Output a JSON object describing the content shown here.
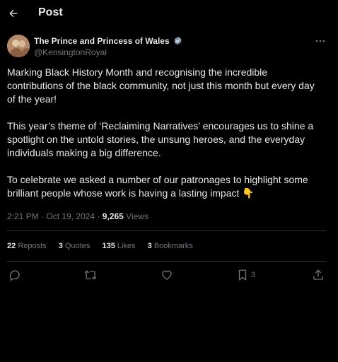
{
  "header": {
    "title": "Post"
  },
  "author": {
    "name": "The Prince and Princess of Wales",
    "handle": "@KensingtonRoyal"
  },
  "tweet": {
    "paragraphs": [
      "Marking Black History Month and recognising the incredible contributions of the black community, not just this month but every day of the year!",
      "This year’s theme of ‘Reclaiming Narratives’ encourages us to shine a spotlight on the untold stories, the unsung heroes, and the everyday individuals making a big difference.",
      "To celebrate we asked a number of our patronages to highlight some brilliant people whose work is having a lasting impact 👇"
    ]
  },
  "meta": {
    "time": "2:21 PM",
    "separator": "·",
    "date": "Oct 19, 2024",
    "views_count": "9,265",
    "views_label": "Views"
  },
  "stats": {
    "reposts_count": "22",
    "reposts_label": "Reposts",
    "quotes_count": "3",
    "quotes_label": "Quotes",
    "likes_count": "135",
    "likes_label": "Likes",
    "bookmarks_count": "3",
    "bookmarks_label": "Bookmarks"
  },
  "actions": {
    "bookmark_count": "3"
  },
  "icons": {
    "back": "arrow-left-icon",
    "verified": "verified-badge-icon",
    "more": "more-icon",
    "reply": "reply-icon",
    "repost": "repost-icon",
    "like": "heart-icon",
    "bookmark": "bookmark-icon",
    "share": "share-icon"
  },
  "colors": {
    "background": "#000000",
    "text": "#e7e9ea",
    "secondary": "#71767b",
    "divider": "#2f3336",
    "verified": "#829aab"
  }
}
